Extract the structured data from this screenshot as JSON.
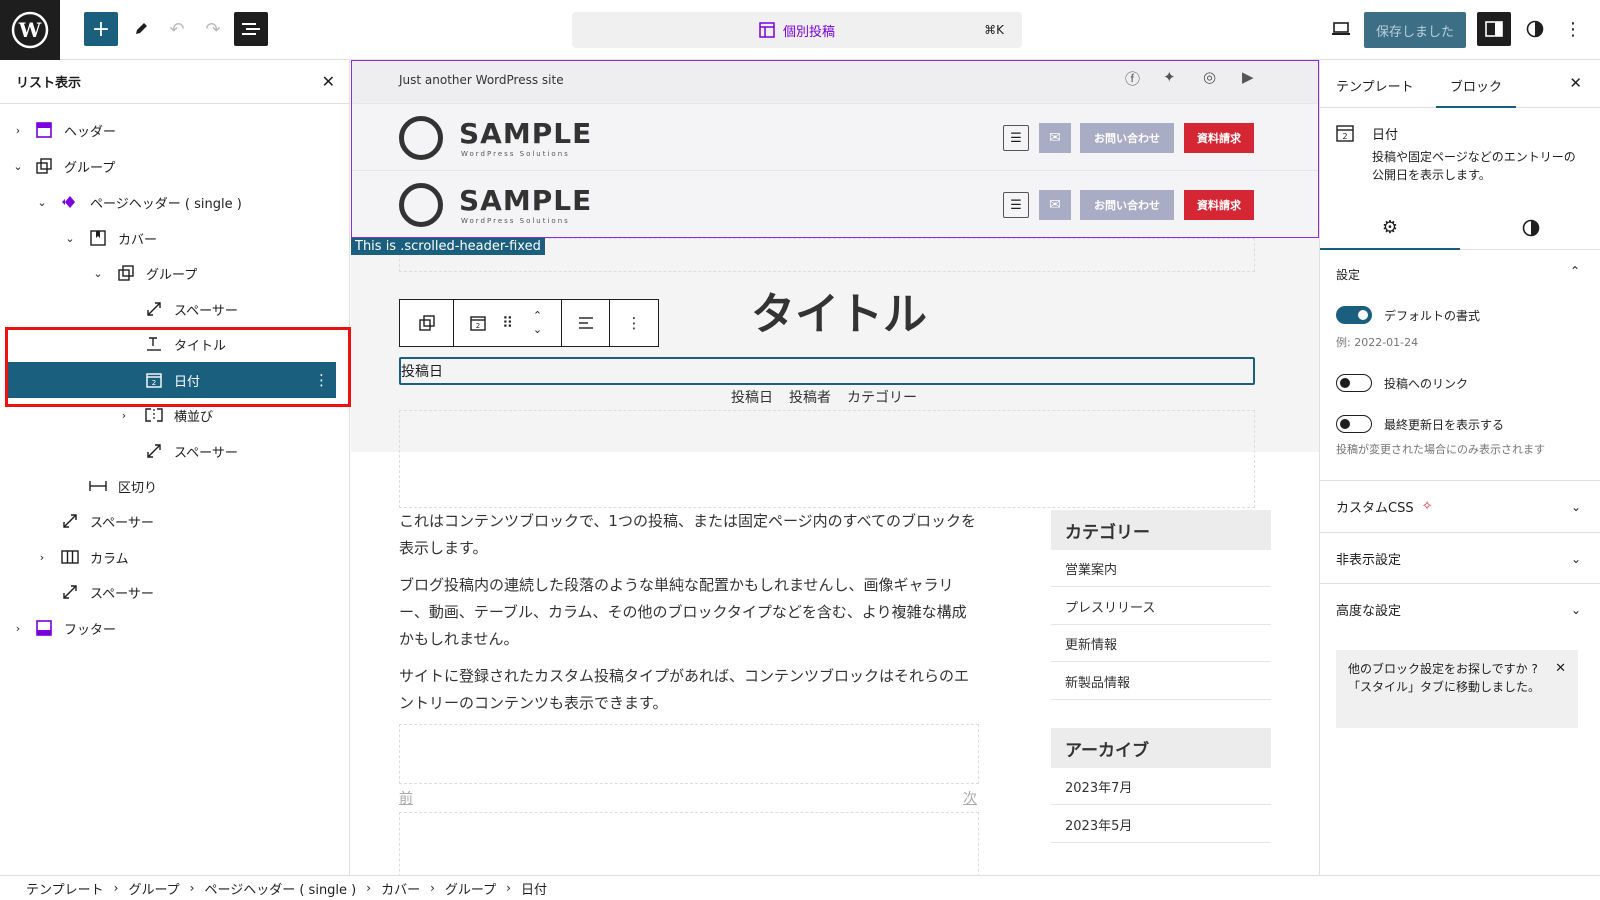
{
  "topbar": {
    "command_label": "個別投稿",
    "command_shortcut": "⌘K",
    "save_label": "保存しました"
  },
  "list_view": {
    "title": "リスト表示",
    "items": [
      {
        "label": "ヘッダー",
        "icon": "template-part-icon"
      },
      {
        "label": "グループ",
        "icon": "group-icon"
      },
      {
        "label": "ページヘッダー ( single )",
        "icon": "pattern-icon"
      },
      {
        "label": "カバー",
        "icon": "cover-icon"
      },
      {
        "label": "グループ",
        "icon": "group-icon"
      },
      {
        "label": "スペーサー",
        "icon": "spacer-icon"
      },
      {
        "label": "タイトル",
        "icon": "title-icon"
      },
      {
        "label": "日付",
        "icon": "date-icon"
      },
      {
        "label": "横並び",
        "icon": "row-icon"
      },
      {
        "label": "スペーサー",
        "icon": "spacer-icon"
      },
      {
        "label": "区切り",
        "icon": "separator-icon"
      },
      {
        "label": "スペーサー",
        "icon": "spacer-icon"
      },
      {
        "label": "カラム",
        "icon": "columns-icon"
      },
      {
        "label": "スペーサー",
        "icon": "spacer-icon"
      },
      {
        "label": "フッター",
        "icon": "template-part-icon"
      }
    ]
  },
  "canvas": {
    "tagline": "Just another WordPress site",
    "logo_text": "SAMPLE",
    "logo_sub": "WordPress Solutions",
    "contact_label": "お問い合わせ",
    "request_label": "資料請求",
    "header_tag": "This is .scrolled-header-fixed",
    "page_title": "タイトル",
    "date_value": "投稿日",
    "meta": [
      "投稿日",
      "投稿者",
      "カテゴリー"
    ],
    "paragraphs": [
      "これはコンテンツブロックで、1つの投稿、または固定ページ内のすべてのブロックを表示します。",
      "ブログ投稿内の連続した段落のような単純な配置かもしれませんし、画像ギャラリー、動画、テーブル、カラム、その他のブロックタイプなどを含む、より複雑な構成かもしれません。",
      "サイトに登録されたカスタム投稿タイプがあれば、コンテンツブロックはそれらのエントリーのコンテンツも表示できます。"
    ],
    "prev_label": "前",
    "next_label": "次",
    "category_title": "カテゴリー",
    "categories": [
      "営業案内",
      "プレスリリース",
      "更新情報",
      "新製品情報"
    ],
    "archive_title": "アーカイブ",
    "archives": [
      "2023年7月",
      "2023年5月"
    ]
  },
  "inspector": {
    "tab_template": "テンプレート",
    "tab_block": "ブロック",
    "block_name": "日付",
    "block_desc": "投稿や固定ページなどのエントリーの公開日を表示します。",
    "settings_title": "設定",
    "default_format_label": "デフォルトの書式",
    "default_format_on": true,
    "example": "例: 2022-01-24",
    "link_label": "投稿へのリンク",
    "link_on": false,
    "modified_label": "最終更新日を表示する",
    "modified_on": false,
    "modified_help": "投稿が変更された場合にのみ表示されます",
    "custom_css": "カスタムCSS",
    "hidden_settings": "非表示設定",
    "advanced": "高度な設定",
    "notice": "他のブロック設定をお探しですか ?「スタイル」タブに移動しました。"
  },
  "breadcrumb": [
    "テンプレート",
    "グループ",
    "ページヘッダー ( single )",
    "カバー",
    "グループ",
    "日付"
  ],
  "colors": {
    "accent": "#1b5f7f",
    "purple": "#7a00df",
    "red": "#d42633"
  }
}
